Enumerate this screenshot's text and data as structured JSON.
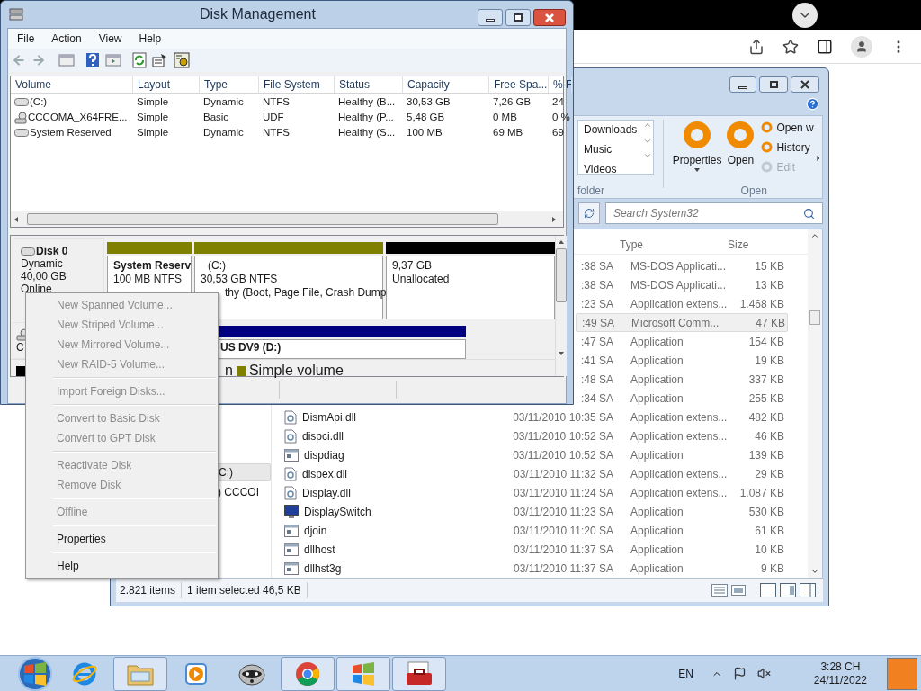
{
  "disk_management": {
    "title": "Disk Management",
    "menu": [
      "File",
      "Action",
      "View",
      "Help"
    ],
    "columns": [
      "Volume",
      "Layout",
      "Type",
      "File System",
      "Status",
      "Capacity",
      "Free Spa...",
      "% F"
    ],
    "volumes": [
      {
        "kind": "disk",
        "cells": [
          "(C:)",
          "Simple",
          "Dynamic",
          "NTFS",
          "Healthy (B...",
          "30,53 GB",
          "7,26 GB",
          "24"
        ]
      },
      {
        "kind": "cd",
        "cells": [
          "CCCOMA_X64FRE...",
          "Simple",
          "Basic",
          "UDF",
          "Healthy (P...",
          "5,48 GB",
          "0 MB",
          "0 %"
        ]
      },
      {
        "kind": "disk",
        "cells": [
          "System Reserved",
          "Simple",
          "Dynamic",
          "NTFS",
          "Healthy (S...",
          "100 MB",
          "69 MB",
          "69"
        ]
      }
    ],
    "disks": [
      {
        "kind": "disk",
        "label": [
          "Disk 0",
          "Dynamic",
          "40,00 GB",
          "Online"
        ],
        "partitions": [
          {
            "color": "#808000",
            "name": "System Reserv",
            "lines": [
              "100 MB NTFS"
            ]
          },
          {
            "color": "#808000",
            "name": "(C:)",
            "lines": [
              "30,53 GB NTFS",
              "thy (Boot, Page File, Crash Dump"
            ]
          },
          {
            "color": "#000000",
            "lines": [
              "9,37 GB",
              "Unallocated"
            ]
          }
        ]
      },
      {
        "kind": "cd",
        "label": [
          "C"
        ],
        "partitions": [
          {
            "color": "#000080",
            "name": "US DV9 (D:)"
          }
        ]
      }
    ],
    "legend": [
      {
        "color": "#000000"
      },
      {
        "label": "n"
      },
      {
        "color": "#808000",
        "label": "Simple volume"
      }
    ]
  },
  "context_menu": {
    "groups": [
      [
        {
          "label": "New Spanned Volume...",
          "disabled": true
        },
        {
          "label": "New Striped Volume...",
          "disabled": true
        },
        {
          "label": "New Mirrored Volume...",
          "disabled": true
        },
        {
          "label": "New RAID-5 Volume...",
          "disabled": true
        }
      ],
      [
        {
          "label": "Import Foreign Disks...",
          "disabled": true
        }
      ],
      [
        {
          "label": "Convert to Basic Disk",
          "disabled": true
        },
        {
          "label": "Convert to GPT Disk",
          "disabled": true
        }
      ],
      [
        {
          "label": "Reactivate Disk",
          "disabled": true
        },
        {
          "label": "Remove Disk",
          "disabled": true
        }
      ],
      [
        {
          "label": "Offline",
          "disabled": true
        }
      ],
      [
        {
          "label": "Properties",
          "disabled": false
        }
      ],
      [
        {
          "label": "Help",
          "disabled": false
        }
      ]
    ]
  },
  "explorer": {
    "ribbon": {
      "list": [
        "Downloads",
        "Music",
        "Videos"
      ],
      "list_group": "folder",
      "buttons": [
        {
          "label": "Properties",
          "dropdown": true
        },
        {
          "label": "Open",
          "dropdown": false
        }
      ],
      "small_buttons": [
        {
          "label": "Open w",
          "disabled": false
        },
        {
          "label": "History",
          "disabled": false
        },
        {
          "label": "Edit",
          "disabled": true
        }
      ],
      "group": "Open"
    },
    "search": {
      "placeholder": "Search System32"
    },
    "nav": [
      {
        "label": "C:)",
        "selected": true
      },
      {
        "label": ") CCCOI",
        "selected": false
      }
    ],
    "columns": [
      "Type",
      "Size"
    ],
    "files": [
      {
        "date": ":38 SA",
        "type": "MS-DOS Applicati...",
        "size": "15 KB",
        "selected": false
      },
      {
        "date": ":38 SA",
        "type": "MS-DOS Applicati...",
        "size": "13 KB",
        "selected": false
      },
      {
        "date": ":23 SA",
        "type": "Application extens...",
        "size": "1.468 KB",
        "selected": false
      },
      {
        "date": ":49 SA",
        "type": "Microsoft Comm...",
        "size": "47 KB",
        "selected": true
      },
      {
        "date": ":47 SA",
        "type": "Application",
        "size": "154 KB",
        "selected": false
      },
      {
        "date": ":41 SA",
        "type": "Application",
        "size": "19 KB",
        "selected": false
      },
      {
        "date": ":48 SA",
        "type": "Application",
        "size": "337 KB",
        "selected": false
      },
      {
        "date": ":34 SA",
        "type": "Application",
        "size": "255 KB",
        "selected": false
      },
      {
        "kind": "dll",
        "name": "DismApi.dll",
        "date": "03/11/2010 10:35 SA",
        "type": "Application extens...",
        "size": "482 KB",
        "selected": false
      },
      {
        "kind": "dll",
        "name": "dispci.dll",
        "date": "03/11/2010 10:52 SA",
        "type": "Application extens...",
        "size": "46 KB",
        "selected": false
      },
      {
        "kind": "app",
        "name": "dispdiag",
        "date": "03/11/2010 10:52 SA",
        "type": "Application",
        "size": "139 KB",
        "selected": false
      },
      {
        "kind": "dll",
        "name": "dispex.dll",
        "date": "03/11/2010 11:32 SA",
        "type": "Application extens...",
        "size": "29 KB",
        "selected": false
      },
      {
        "kind": "dll",
        "name": "Display.dll",
        "date": "03/11/2010 11:24 SA",
        "type": "Application extens...",
        "size": "1.087 KB",
        "selected": false
      },
      {
        "kind": "monitor",
        "name": "DisplaySwitch",
        "date": "03/11/2010 11:23 SA",
        "type": "Application",
        "size": "530 KB",
        "selected": false
      },
      {
        "kind": "app",
        "name": "djoin",
        "date": "03/11/2010 11:20 SA",
        "type": "Application",
        "size": "61 KB",
        "selected": false
      },
      {
        "kind": "app",
        "name": "dllhost",
        "date": "03/11/2010 11:37 SA",
        "type": "Application",
        "size": "10 KB",
        "selected": false
      },
      {
        "kind": "app",
        "name": "dllhst3g",
        "date": "03/11/2010 11:37 SA",
        "type": "Application",
        "size": "9 KB",
        "selected": false
      }
    ],
    "status": [
      "2.821 items",
      "1 item selected 46,5 KB"
    ]
  },
  "taskbar": {
    "apps": [
      {
        "kind": "ie",
        "running": false
      },
      {
        "kind": "folder",
        "running": true
      },
      {
        "kind": "media",
        "running": false
      },
      {
        "kind": "raccoon",
        "running": false
      },
      {
        "kind": "chrome",
        "running": true
      },
      {
        "kind": "windows",
        "running": true
      },
      {
        "kind": "toolbox",
        "running": true
      }
    ],
    "language": "EN",
    "time": "3:28 CH",
    "date": "24/11/2022"
  }
}
